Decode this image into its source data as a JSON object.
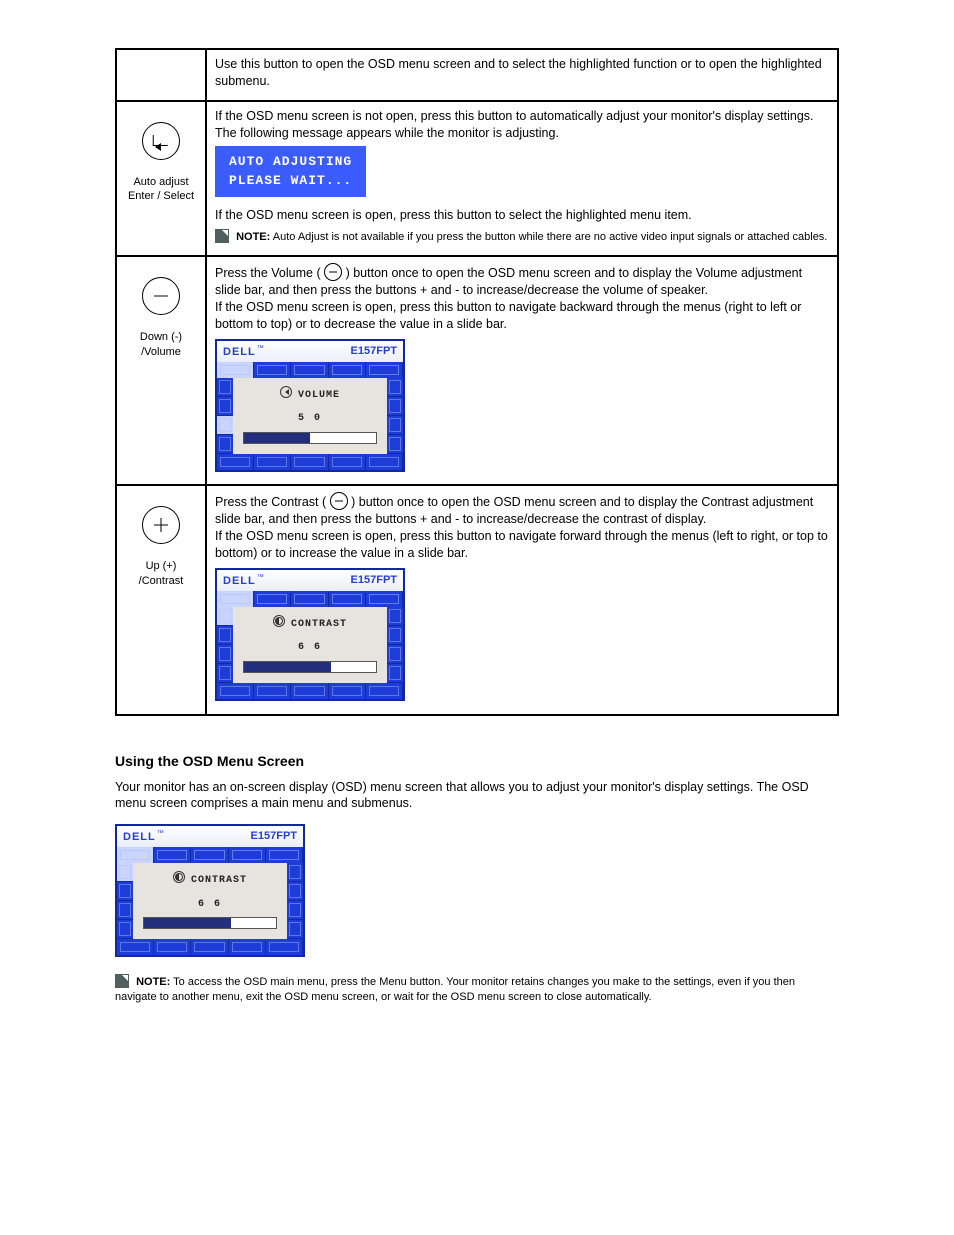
{
  "table": {
    "row0_text": "Use this button to open the OSD menu screen and to select the highlighted function or to open the highlighted submenu.",
    "row1": {
      "btn_label": "Auto adjust Enter / Select",
      "before_banner": "If the OSD menu screen is not open, press this button to automatically adjust your monitor's display settings. The following message appears while the monitor is adjusting.",
      "banner_line1": "AUTO ADJUSTING",
      "banner_line2": "PLEASE WAIT...",
      "after_banner": "If the OSD menu screen is open, press this button to select the highlighted menu item.",
      "note_label": "NOTE:",
      "note_text": "Auto Adjust is not available if you press the button while there are no active video input signals or attached cables."
    },
    "row2": {
      "btn_label": "Down (-) /Volume",
      "pre": "Press the Volume (",
      "post": ") button once to open the OSD menu screen and to display the Volume adjustment slide bar, and then press the buttons + and - to increase/decrease the volume of speaker.",
      "after": "If the OSD menu screen is open, press this button to navigate backward through the menus (right to left or bottom to top) or to decrease the value in a slide bar.",
      "osd": {
        "brand": "DELL",
        "model": "E157FPT",
        "label": "VOLUME",
        "value": "5 0",
        "percent": 50
      }
    },
    "row3": {
      "btn_label": "Up (+) /Contrast",
      "pre": "Press the Contrast (",
      "post": ") button once to open the OSD menu screen and to display the Contrast adjustment slide bar, and then press the buttons + and - to increase/decrease the contrast of display.",
      "after": "If the OSD menu screen is open, press this button to navigate forward through the menus (left to right, or top to bottom) or to increase the value in a slide bar.",
      "osd": {
        "brand": "DELL",
        "model": "E157FPT",
        "label": "CONTRAST",
        "value": "6 6",
        "percent": 66
      }
    }
  },
  "below": {
    "heading": "Using the OSD Menu Screen",
    "p1": "Your monitor has an on-screen display (OSD) menu screen that allows you to adjust your monitor's display settings. The OSD menu screen comprises a main menu and submenus.",
    "osd": {
      "brand": "DELL",
      "model": "E157FPT",
      "label": "CONTRAST",
      "value": "6 6",
      "percent": 66
    },
    "note_label": "NOTE:",
    "note_text": "To access the OSD main menu, press the Menu button. Your monitor retains changes you make to the settings, even if you then navigate to another menu, exit the OSD menu screen, or wait for the OSD menu screen to close automatically."
  }
}
